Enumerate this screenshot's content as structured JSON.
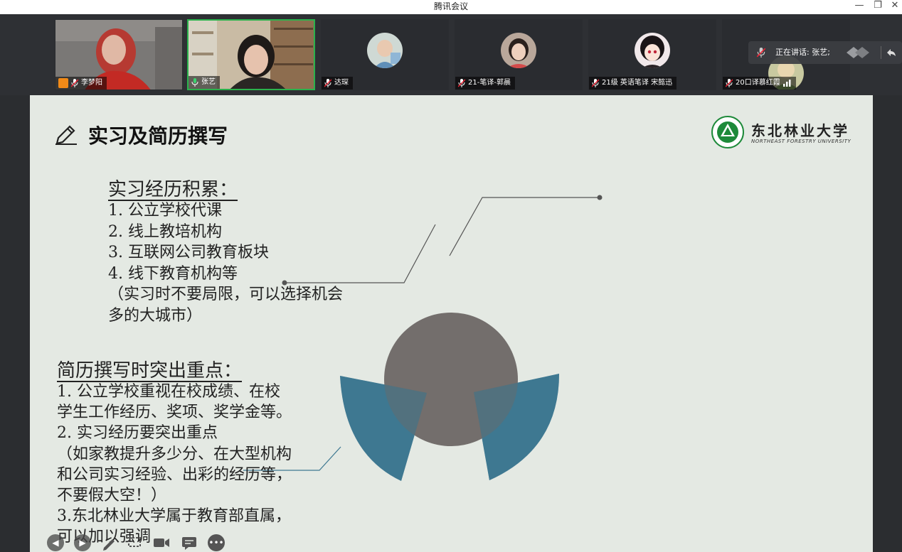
{
  "window": {
    "title": "腾讯会议",
    "minimize_glyph": "—",
    "restore_glyph": "❐",
    "close_glyph": "✕"
  },
  "participants": [
    {
      "name": "李梦阳",
      "host": true,
      "speaking": false,
      "video": "woman-red-jacket"
    },
    {
      "name": "张艺",
      "host": false,
      "speaking": true,
      "video": "woman-bookshelf"
    },
    {
      "name": "达琛",
      "host": false,
      "speaking": false,
      "video": "avatar-child"
    },
    {
      "name": "21-笔译-郭晨",
      "host": false,
      "speaking": false,
      "video": "avatar-girl"
    },
    {
      "name": "21级 英语笔译 宋懿迅",
      "host": false,
      "speaking": false,
      "video": "avatar-anime"
    },
    {
      "name": "20口译慕红霞",
      "host": false,
      "speaking": false,
      "video": "avatar-flower"
    }
  ],
  "speaking_popup": {
    "text": "正在讲话: 张艺;"
  },
  "slide": {
    "title": "实习及简历撰写",
    "university_cn": "东北林业大学",
    "university_en": "NORTHEAST FORESTRY UNIVERSITY",
    "section1": {
      "heading": "实习经历积累：",
      "items": [
        "1.  公立学校代课",
        "2.  线上教培机构",
        "3.  互联网公司教育板块",
        "4.  线下教育机构等"
      ],
      "note_lines": [
        "（实习时不要局限，可以选择机会",
        "多的大城市）"
      ]
    },
    "section2": {
      "heading": "简历撰写时突出重点：",
      "lines": [
        "1.  公立学校重视在校成绩、在校",
        "学生工作经历、奖项、奖学金等。",
        "2.  实习经历要突出重点",
        "（如家教提升多少分、在大型机构",
        "和公司实习经验、出彩的经历等，",
        "不要假大空！）",
        "3.东北林业大学属于教育部直属，",
        "可以加以强调"
      ]
    }
  },
  "colors": {
    "slide_bg": "#e4e9e3",
    "circle": "#6d6765",
    "sector": "#3e7891",
    "speaking_border": "#2bb24c",
    "logo_green": "#1e8a3a"
  },
  "toolbar_icons": [
    "back-arrow-icon",
    "forward-arrow-icon",
    "pen-icon",
    "screen-icon",
    "camera-icon",
    "chat-icon",
    "more-icon"
  ]
}
